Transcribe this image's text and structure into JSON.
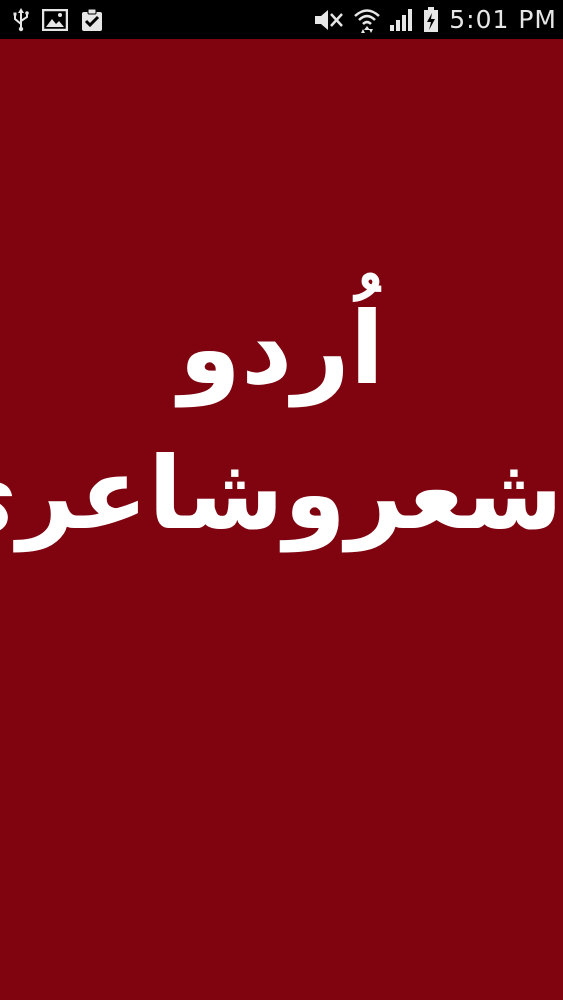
{
  "status_bar": {
    "time": "5:01 PM",
    "icons_left": [
      "usb-icon",
      "image-icon",
      "clipboard-check-icon"
    ],
    "icons_right": [
      "mute-icon",
      "wifi-icon",
      "signal-icon",
      "battery-charging-icon"
    ]
  },
  "splash": {
    "background_color": "#7f0410",
    "title_line1": "اُردو",
    "title_line2": "شعروشاعری"
  }
}
